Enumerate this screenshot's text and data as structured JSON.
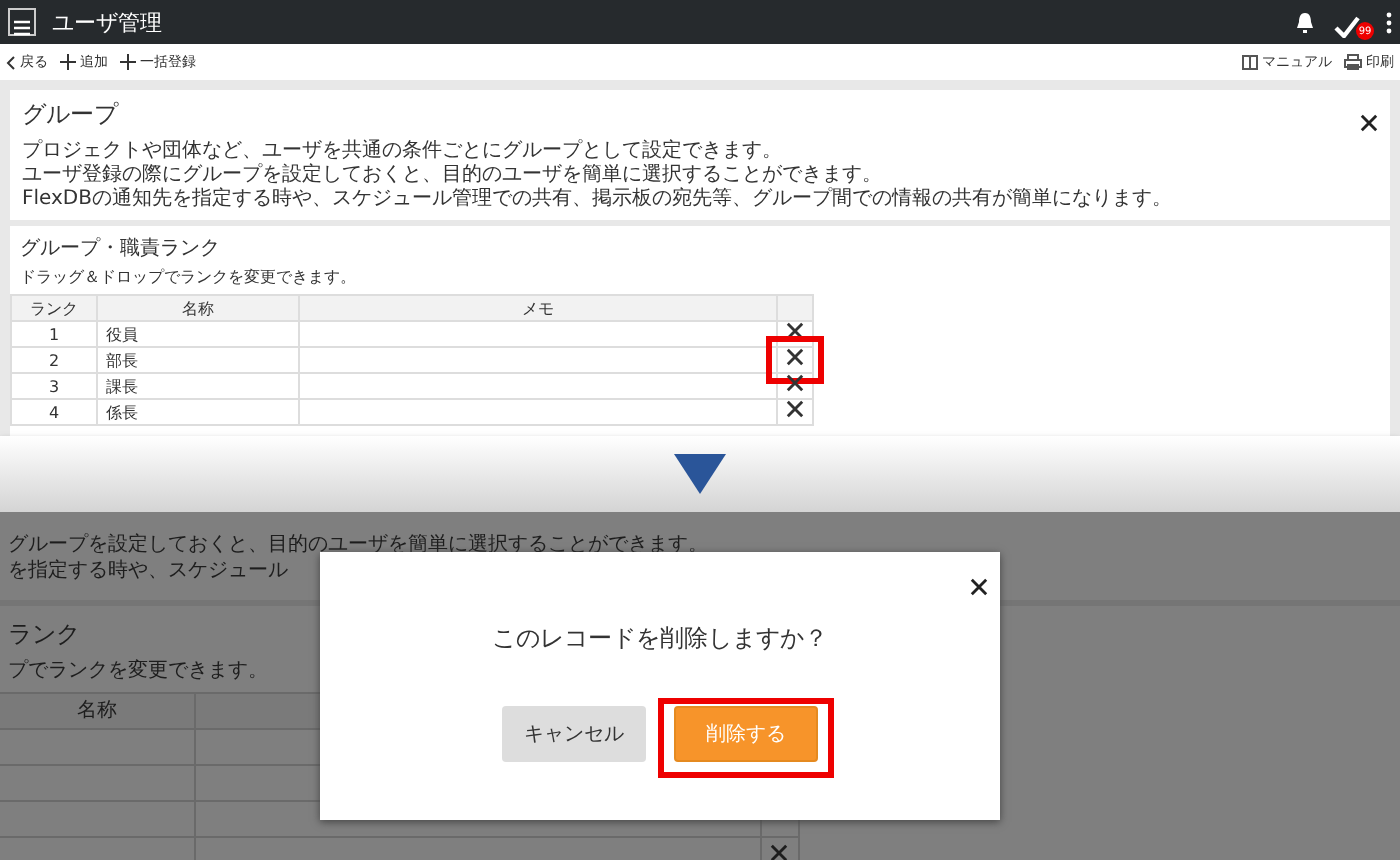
{
  "header": {
    "title": "ユーザ管理",
    "badge": "99"
  },
  "toolbar": {
    "left": [
      {
        "label": "戻る",
        "kind": "back"
      },
      {
        "label": "追加",
        "kind": "add"
      },
      {
        "label": "一括登録",
        "kind": "add"
      }
    ],
    "right": [
      {
        "label": "マニュアル",
        "kind": "manual"
      },
      {
        "label": "印刷",
        "kind": "print"
      }
    ]
  },
  "info_panel": {
    "title": "グループ",
    "lines": [
      "プロジェクトや団体など、ユーザを共通の条件ごとにグループとして設定できます。",
      "ユーザ登録の際にグループを設定しておくと、目的のユーザを簡単に選択することができます。",
      "FlexDBの通知先を指定する時や、スケジュール管理での共有、掲示板の宛先等、グループ間での情報の共有が簡単になります。"
    ]
  },
  "rank_section": {
    "title": "グループ・職責ランク",
    "hint": "ドラッグ＆ドロップでランクを変更できます。",
    "columns": [
      "ランク",
      "名称",
      "メモ"
    ],
    "rows": [
      {
        "rank": "1",
        "name": "役員",
        "highlighted": false
      },
      {
        "rank": "2",
        "name": "部長",
        "highlighted": true
      },
      {
        "rank": "3",
        "name": "課長",
        "highlighted": false
      },
      {
        "rank": "4",
        "name": "係長",
        "highlighted": false
      }
    ]
  },
  "after": {
    "lines": [
      "グループを設定しておくと、目的のユーザを簡単に選択することができます。",
      "を指定する時や、スケジュール"
    ],
    "title": "ランク",
    "hint": "プでランクを変更できます。",
    "columns": [
      "名称"
    ]
  },
  "dialog": {
    "message": "このレコードを削除しますか？",
    "buttons": [
      {
        "label": "キャンセル",
        "kind": "cancel",
        "highlighted": false
      },
      {
        "label": "削除する",
        "kind": "confirm",
        "highlighted": true
      }
    ]
  }
}
